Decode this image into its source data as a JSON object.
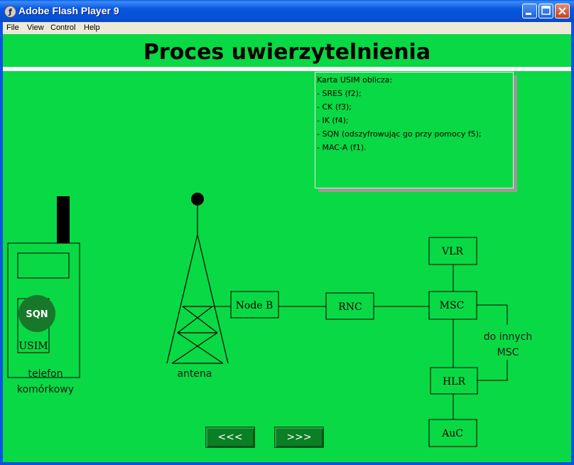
{
  "window": {
    "title": "Adobe Flash Player 9"
  },
  "menu": [
    "File",
    "View",
    "Control",
    "Help"
  ],
  "slide": {
    "title": "Proces uwierzytelnienia",
    "info": {
      "heading": "Karta USIM oblicza:",
      "items": [
        "- SRES (f2);",
        "- CK (f3);",
        "- IK (f4);",
        "- SQN (odszyfrowując go przy pomocy f5);",
        "- MAC-A (f1)."
      ]
    },
    "phone": {
      "badge": "SQN",
      "usim_label": "USIM",
      "caption_line1": "telefon",
      "caption_line2": "komórkowy"
    },
    "antenna_label": "antena",
    "nodes": {
      "nodeb": "Node B",
      "rnc": "RNC",
      "msc": "MSC",
      "vlr": "VLR",
      "hlr": "HLR",
      "auc": "AuC"
    },
    "other_msc_line1": "do innych",
    "other_msc_line2": "MSC"
  },
  "nav": {
    "prev_label": "<<<",
    "next_label": ">>>"
  },
  "colors": {
    "stage_bg": "#09d944",
    "sqn_circle": "#17782a",
    "nav_button": "#0b7f24"
  }
}
